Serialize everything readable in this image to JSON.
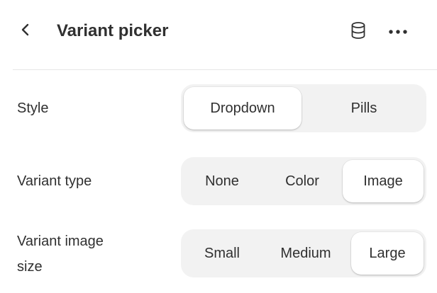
{
  "header": {
    "back_icon": "chevron-left-icon",
    "title": "Variant picker",
    "db_icon": "database-icon",
    "more_icon": "more-horizontal-icon"
  },
  "settings": {
    "style": {
      "label": "Style",
      "options": [
        "Dropdown",
        "Pills"
      ],
      "selected": "Dropdown"
    },
    "variant_type": {
      "label": "Variant type",
      "options": [
        "None",
        "Color",
        "Image"
      ],
      "selected": "Image"
    },
    "variant_image_size": {
      "label_line1": "Variant image",
      "label_line2": "size",
      "options": [
        "Small",
        "Medium",
        "Large"
      ],
      "selected": "Large"
    }
  },
  "colors": {
    "text": "#303030",
    "segment_bg": "#f2f2f2",
    "selected_bg": "#ffffff",
    "divider": "#e6e6e6"
  }
}
